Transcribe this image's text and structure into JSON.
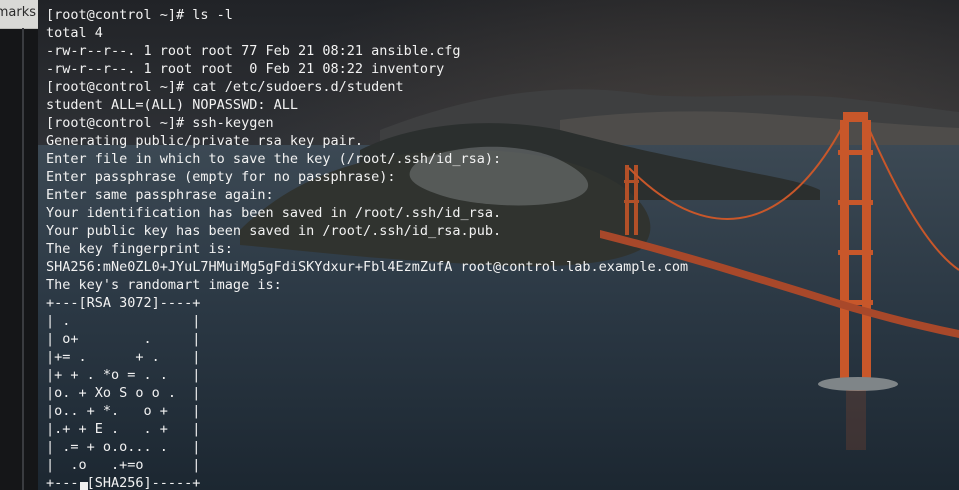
{
  "sidebar": {
    "bookmarks_label": "marks"
  },
  "terminal": {
    "lines": [
      "[root@control ~]# ls -l",
      "total 4",
      "-rw-r--r--. 1 root root 77 Feb 21 08:21 ansible.cfg",
      "-rw-r--r--. 1 root root  0 Feb 21 08:22 inventory",
      "[root@control ~]# cat /etc/sudoers.d/student",
      "student ALL=(ALL) NOPASSWD: ALL",
      "[root@control ~]# ssh-keygen",
      "Generating public/private rsa key pair.",
      "Enter file in which to save the key (/root/.ssh/id_rsa):",
      "Enter passphrase (empty for no passphrase):",
      "Enter same passphrase again:",
      "Your identification has been saved in /root/.ssh/id_rsa.",
      "Your public key has been saved in /root/.ssh/id_rsa.pub.",
      "The key fingerprint is:",
      "SHA256:mNe0ZL0+JYuL7HMuiMg5gFdiSKYdxur+Fbl4EzmZufA root@control.lab.example.com",
      "The key's randomart image is:",
      "+---[RSA 3072]----+",
      "| .               |",
      "| o+        .     |",
      "|+= .      + .    |",
      "|+ + . *o = . .   |",
      "|o. + Xo S o o .  |",
      "|o.. + *.   o +   |",
      "|.+ + E .   . +   |",
      "| .= + o.o... .   |",
      "|  .o   .+=o      |",
      "+----[SHA256]-----+"
    ],
    "text_color": "#f2f2f2"
  },
  "wallpaper": {
    "subject": "golden-gate-bridge-at-dusk",
    "bridge_color": "#c8572a",
    "sky_color": "#2a2d33",
    "water_color": "#2b3a47"
  }
}
